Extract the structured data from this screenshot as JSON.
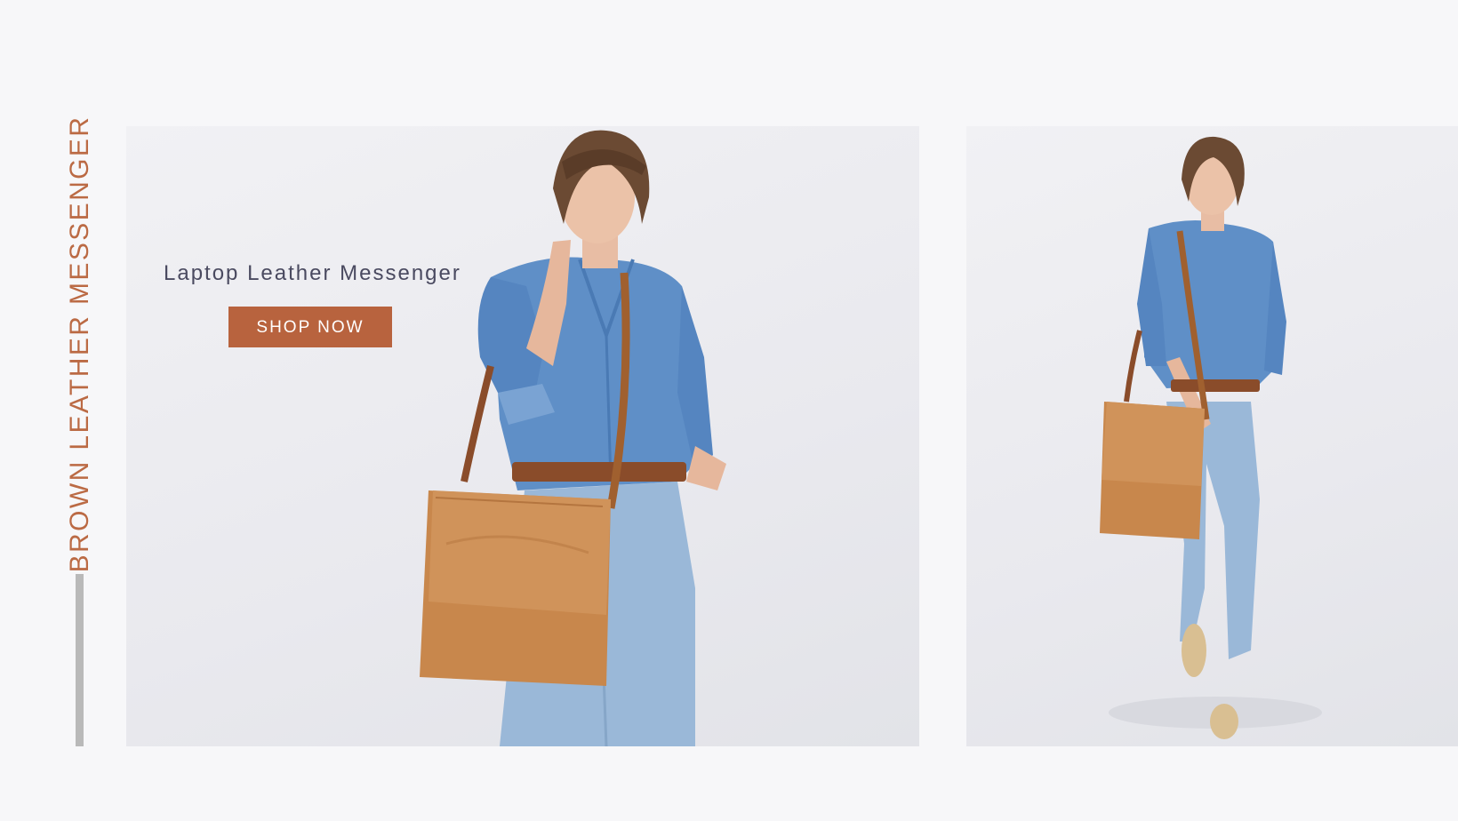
{
  "side_title": "BROWN LEATHER MESSENGER",
  "slides": [
    {
      "title": "Laptop Leather Messenger",
      "button_label": "SHOP NOW"
    },
    {}
  ],
  "colors": {
    "accent": "#bb6a44",
    "button": "#b8633e",
    "caption_text": "#4a4a60",
    "side_bar": "#b9b9b9",
    "background": "#f7f7f9"
  }
}
